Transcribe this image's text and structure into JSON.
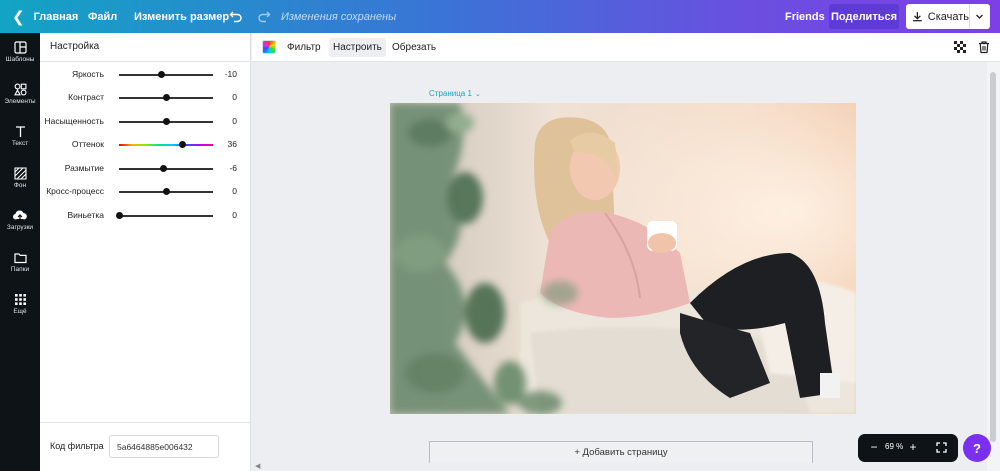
{
  "topbar": {
    "home_label": "Главная",
    "file_label": "Файл",
    "resize_label": "Изменить размер",
    "saved_status": "Изменения сохранены",
    "friends_label": "Friends",
    "share_label": "Поделиться",
    "download_label": "Скачать"
  },
  "rail": {
    "items": [
      {
        "label": "Шаблоны",
        "icon": "templates-icon"
      },
      {
        "label": "Элементы",
        "icon": "elements-icon"
      },
      {
        "label": "Текст",
        "icon": "text-icon"
      },
      {
        "label": "Фон",
        "icon": "background-icon"
      },
      {
        "label": "Загрузки",
        "icon": "upload-icon"
      },
      {
        "label": "Папки",
        "icon": "folder-icon"
      },
      {
        "label": "Ещё",
        "icon": "more-grid-icon"
      }
    ]
  },
  "panel": {
    "title": "Настройка",
    "sliders": [
      {
        "label": "Яркость",
        "value": "-10",
        "level": -10
      },
      {
        "label": "Контраст",
        "value": "0",
        "level": 0
      },
      {
        "label": "Насыщенность",
        "value": "0",
        "level": 0
      },
      {
        "label": "Оттенок",
        "value": "36",
        "level": 36
      },
      {
        "label": "Размытие",
        "value": "-6",
        "level": -6
      },
      {
        "label": "Кросс-процесс",
        "value": "0",
        "level": 0
      },
      {
        "label": "Виньетка",
        "value": "0",
        "level": 0
      }
    ],
    "filter_code_label": "Код фильтра",
    "filter_code_value": "5a6464885e006432"
  },
  "canvas_toolbar": {
    "filter_tab": "Фильтр",
    "adjust_tab": "Настроить",
    "crop_tab": "Обрезать"
  },
  "workspace": {
    "page_label": "Страница 1",
    "add_page_label": "+ Добавить страницу"
  },
  "zoom": {
    "value": "69 %",
    "minus": "−",
    "plus": "+"
  },
  "help_label": "?",
  "colors": {
    "accent_purple": "#7b2ff0",
    "share_bg": "#5e3ad6",
    "rail_bg": "#0e1318",
    "page_label": "#1aa6b7"
  }
}
